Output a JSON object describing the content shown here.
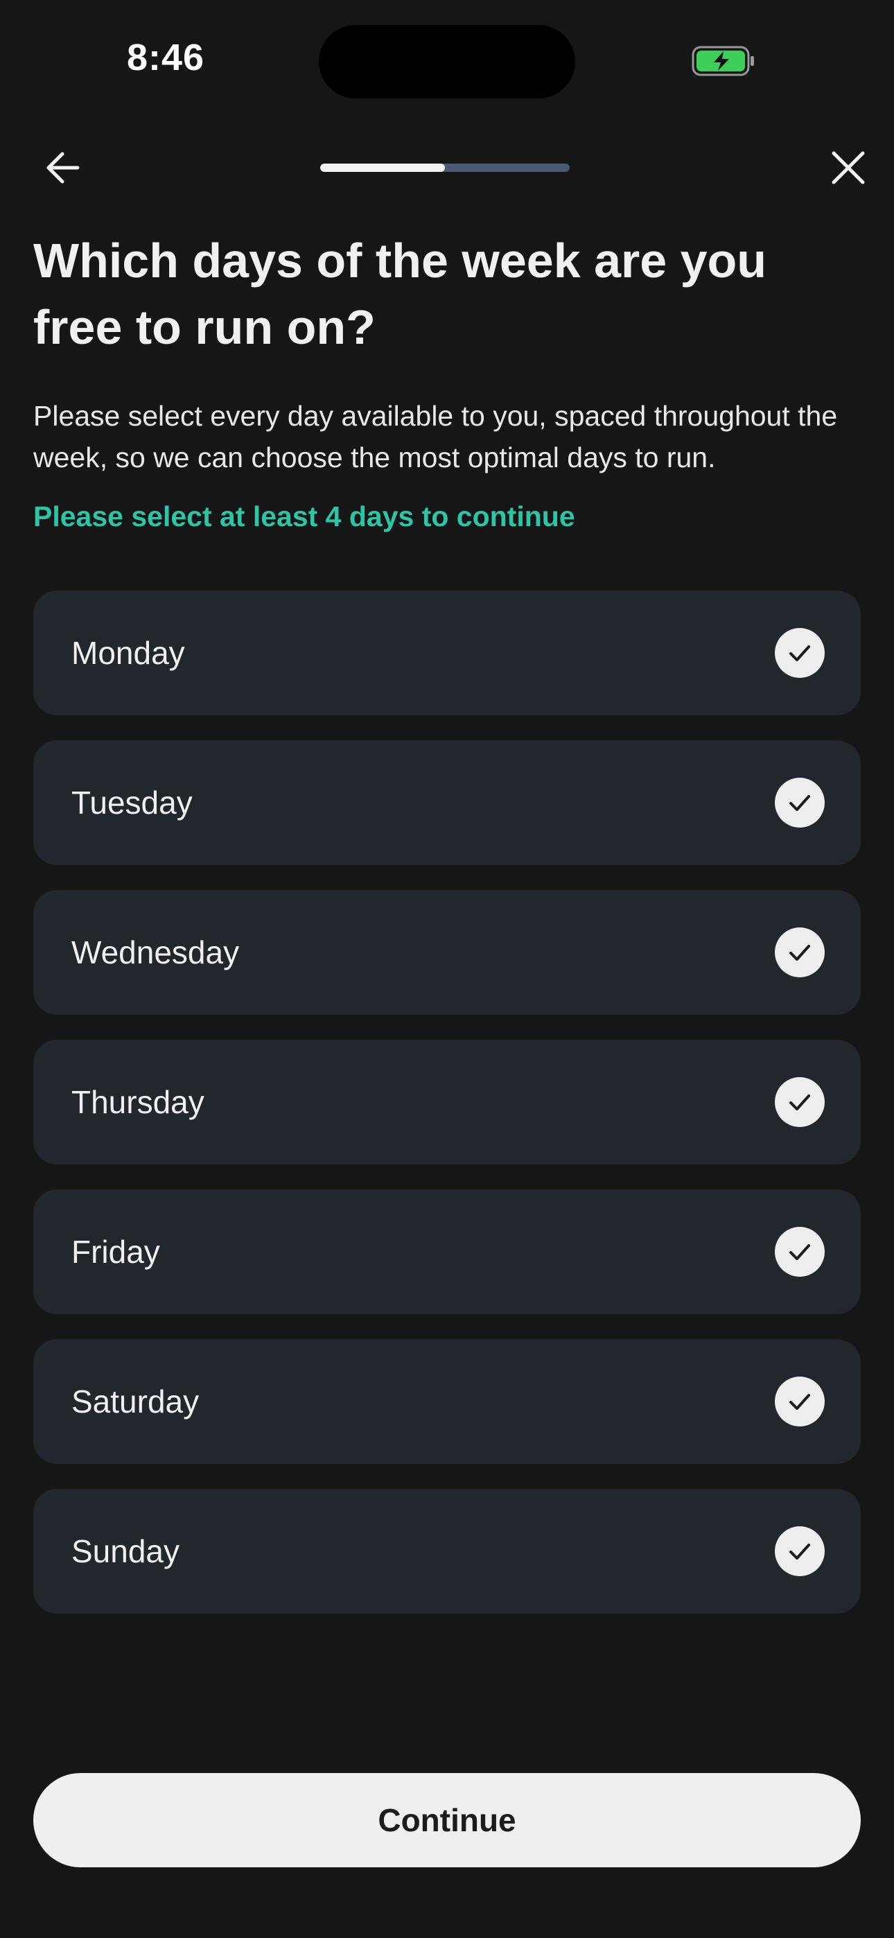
{
  "status_bar": {
    "time": "8:46",
    "battery_color": "#3ecf5a"
  },
  "nav": {
    "back_icon": "arrow-left-icon",
    "close_icon": "close-icon",
    "progress_fraction": 0.5,
    "progress_fill_color": "#f2f2f2",
    "progress_track_color": "#4b5a72"
  },
  "header": {
    "title": "Which days of the week are you free to run on?",
    "subtitle": "Please select every day available to you, spaced throughout the week, so we can choose the most optimal days to run.",
    "hint": "Please select at least 4 days to continue",
    "hint_color": "#2ec4a6"
  },
  "days": [
    {
      "label": "Monday",
      "selected": true
    },
    {
      "label": "Tuesday",
      "selected": true
    },
    {
      "label": "Wednesday",
      "selected": true
    },
    {
      "label": "Thursday",
      "selected": true
    },
    {
      "label": "Friday",
      "selected": true
    },
    {
      "label": "Saturday",
      "selected": true
    },
    {
      "label": "Sunday",
      "selected": true
    }
  ],
  "footer": {
    "continue_label": "Continue"
  }
}
